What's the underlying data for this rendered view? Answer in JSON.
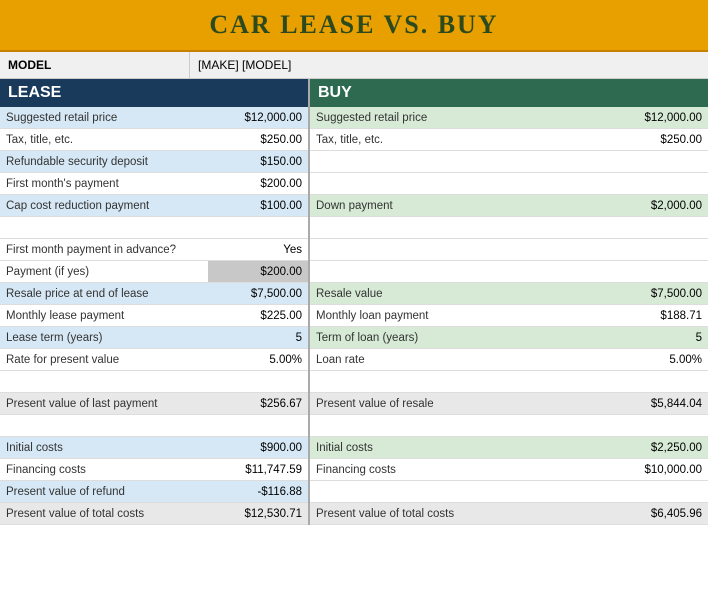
{
  "title": "CAR LEASE VS. BUY",
  "model_label": "MODEL",
  "model_value": "[MAKE] [MODEL]",
  "lease": {
    "header": "LEASE",
    "rows": [
      {
        "label": "Suggested retail price",
        "value": "$12,000.00",
        "label_bg": "bg-light-blue",
        "value_bg": "bg-light-blue"
      },
      {
        "label": "Tax, title, etc.",
        "value": "$250.00",
        "label_bg": "bg-white",
        "value_bg": "bg-white"
      },
      {
        "label": "Refundable security deposit",
        "value": "$150.00",
        "label_bg": "bg-light-blue",
        "value_bg": "bg-light-blue"
      },
      {
        "label": "First month's payment",
        "value": "$200.00",
        "label_bg": "bg-white",
        "value_bg": "bg-white"
      },
      {
        "label": "Cap cost reduction payment",
        "value": "$100.00",
        "label_bg": "bg-light-blue",
        "value_bg": "bg-light-blue"
      },
      {
        "label": "",
        "value": "",
        "label_bg": "bg-white",
        "value_bg": "bg-white",
        "empty": true
      },
      {
        "label": "First month payment in advance?",
        "value": "Yes",
        "label_bg": "bg-white",
        "value_bg": "bg-white",
        "no_dollar": true
      },
      {
        "label": "Payment (if yes)",
        "value": "$200.00",
        "label_bg": "bg-white",
        "value_bg": "bg-gray"
      },
      {
        "label": "Resale price at end of lease",
        "value": "$7,500.00",
        "label_bg": "bg-light-blue",
        "value_bg": "bg-light-blue"
      },
      {
        "label": "Monthly lease payment",
        "value": "$225.00",
        "label_bg": "bg-white",
        "value_bg": "bg-white"
      },
      {
        "label": "Lease term (years)",
        "value": "5",
        "label_bg": "bg-light-blue",
        "value_bg": "bg-light-blue"
      },
      {
        "label": "Rate for present value",
        "value": "5.00%",
        "label_bg": "bg-white",
        "value_bg": "bg-white"
      },
      {
        "label": "",
        "value": "",
        "label_bg": "bg-white",
        "value_bg": "bg-white",
        "empty": true
      },
      {
        "label": "Present value of last payment",
        "value": "$256.67",
        "label_bg": "bg-light-gray",
        "value_bg": "bg-light-gray"
      },
      {
        "label": "",
        "value": "",
        "label_bg": "bg-white",
        "value_bg": "bg-white",
        "empty": true
      },
      {
        "label": "Initial costs",
        "value": "$900.00",
        "label_bg": "bg-light-blue",
        "value_bg": "bg-light-blue"
      },
      {
        "label": "Financing costs",
        "value": "$11,747.59",
        "label_bg": "bg-white",
        "value_bg": "bg-white"
      },
      {
        "label": "Present value of refund",
        "value": "-$116.88",
        "label_bg": "bg-light-blue",
        "value_bg": "bg-light-blue"
      },
      {
        "label": "Present value of total costs",
        "value": "$12,530.71",
        "label_bg": "bg-light-gray",
        "value_bg": "bg-light-gray"
      }
    ]
  },
  "buy": {
    "header": "BUY",
    "rows": [
      {
        "label": "Suggested retail price",
        "value": "$12,000.00",
        "label_bg": "bg-light-green",
        "value_bg": "bg-light-green"
      },
      {
        "label": "Tax, title, etc.",
        "value": "$250.00",
        "label_bg": "bg-white",
        "value_bg": "bg-white"
      },
      {
        "label": "",
        "value": "",
        "empty": true,
        "label_bg": "bg-white",
        "value_bg": "bg-white"
      },
      {
        "label": "",
        "value": "",
        "empty": true,
        "label_bg": "bg-white",
        "value_bg": "bg-white"
      },
      {
        "label": "Down payment",
        "value": "$2,000.00",
        "label_bg": "bg-light-green",
        "value_bg": "bg-light-green"
      },
      {
        "label": "",
        "value": "",
        "empty": true,
        "label_bg": "bg-white",
        "value_bg": "bg-white"
      },
      {
        "label": "",
        "value": "",
        "empty": true,
        "label_bg": "bg-white",
        "value_bg": "bg-white"
      },
      {
        "label": "",
        "value": "",
        "empty": true,
        "label_bg": "bg-white",
        "value_bg": "bg-white"
      },
      {
        "label": "Resale value",
        "value": "$7,500.00",
        "label_bg": "bg-light-green",
        "value_bg": "bg-light-green"
      },
      {
        "label": "Monthly loan payment",
        "value": "$188.71",
        "label_bg": "bg-white",
        "value_bg": "bg-white"
      },
      {
        "label": "Term of loan (years)",
        "value": "5",
        "label_bg": "bg-light-green",
        "value_bg": "bg-light-green"
      },
      {
        "label": "Loan rate",
        "value": "5.00%",
        "label_bg": "bg-white",
        "value_bg": "bg-white"
      },
      {
        "label": "",
        "value": "",
        "empty": true,
        "label_bg": "bg-white",
        "value_bg": "bg-white"
      },
      {
        "label": "Present value of resale",
        "value": "$5,844.04",
        "label_bg": "bg-light-gray",
        "value_bg": "bg-light-gray"
      },
      {
        "label": "",
        "value": "",
        "empty": true,
        "label_bg": "bg-white",
        "value_bg": "bg-white"
      },
      {
        "label": "Initial costs",
        "value": "$2,250.00",
        "label_bg": "bg-light-green",
        "value_bg": "bg-light-green"
      },
      {
        "label": "Financing costs",
        "value": "$10,000.00",
        "label_bg": "bg-white",
        "value_bg": "bg-white"
      },
      {
        "label": "",
        "value": "",
        "empty": true,
        "label_bg": "bg-white",
        "value_bg": "bg-white"
      },
      {
        "label": "Present value of total costs",
        "value": "$6,405.96",
        "label_bg": "bg-light-gray",
        "value_bg": "bg-light-gray"
      }
    ]
  }
}
